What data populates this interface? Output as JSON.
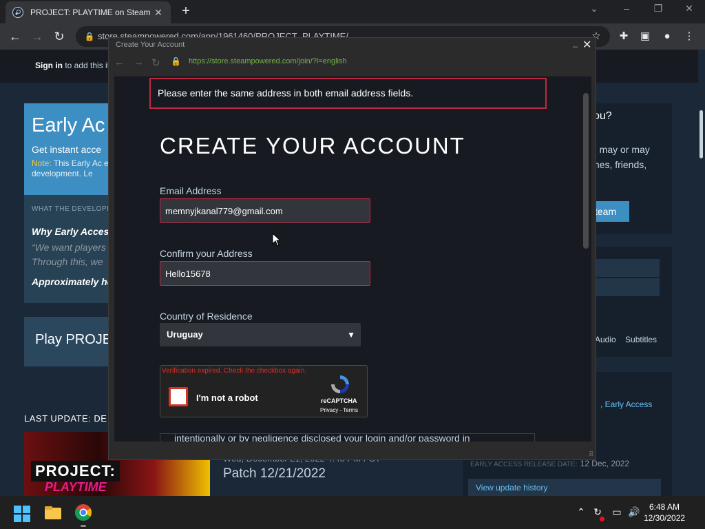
{
  "browser": {
    "tab_title": "PROJECT: PLAYTIME on Steam",
    "close_tab": "✕",
    "new_tab": "+",
    "url": "store.steampowered.com/app/1961460/PROJECT_PLAYTIME/"
  },
  "steam_page": {
    "signin": "Sign in",
    "signin_rest": " to add this it",
    "ea_title": "Early Ac",
    "ea_sub": "Get instant acce",
    "ea_note_label": "Note:",
    "ea_note_text": " This Early Ac excited to play this in development. Le",
    "ea_dev": "WHAT THE DEVELOPE",
    "ea_q1": "Why Early Access",
    "ea_quote": "“We want players Through this, we",
    "ea_q2": "Approximately ho",
    "play": "Play PROJE",
    "last_update": "LAST UPDATE: DE",
    "logo_top": "PROJECT:",
    "logo_bottom": "PLAYTIME",
    "patch_date": "Wed, December 21, 2022 4:48 PM PST",
    "patch_title": "Patch 12/21/2022",
    "right_q": "ou?",
    "right_text": "u may or may mes, friends,",
    "right_btn": "team",
    "lang_tabs": "Audio Subtitles",
    "early_access_link": ", Early Access",
    "release_label": "EARLY ACCESS RELEASE DATE:",
    "release_date": "12 Dec, 2022",
    "view_history": "View update history"
  },
  "popup": {
    "title": "Create Your Account",
    "url": "https://store.steampowered.com/join/?l=english",
    "error": "Please enter the same address in both email address fields.",
    "heading": "CREATE YOUR ACCOUNT",
    "email_label": "Email Address",
    "email_value": "memnyjkanal779@gmail.com",
    "confirm_label": "Confirm your Address",
    "confirm_value": "Hello15678",
    "country_label": "Country of Residence",
    "country_value": "Uruguay",
    "captcha_error": "Verification expired. Check the checkbox again.",
    "captcha_label": "I'm not a robot",
    "captcha_brand": "reCAPTCHA",
    "captcha_links": "Privacy - Terms",
    "terms_text": "intentionally or by negligence disclosed your login and/or password in"
  },
  "taskbar": {
    "time": "6:48 AM",
    "date": "12/30/2022"
  },
  "colors": {
    "error_red": "#c02942",
    "steam_blue": "#3d8ec2",
    "link_green": "#73b24b"
  }
}
